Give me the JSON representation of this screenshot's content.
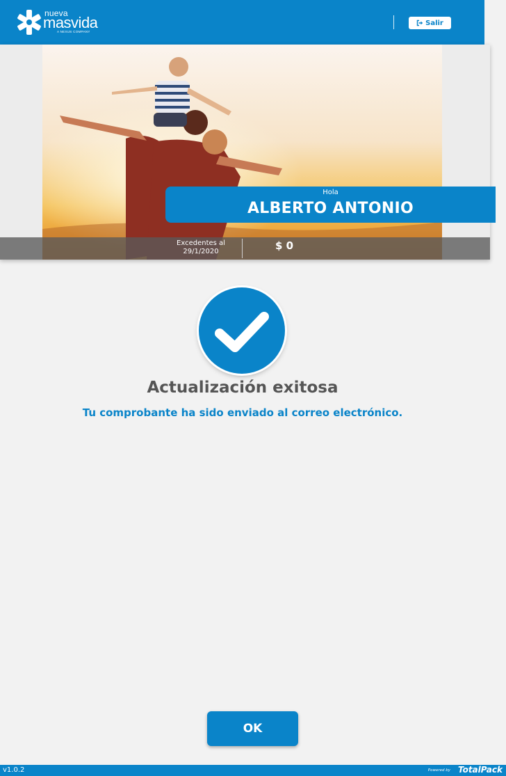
{
  "header": {
    "logo_small": "nueva",
    "logo_main": "masvida",
    "logo_tagline": "A NEXUS COMPANY",
    "logout_label": "Salir"
  },
  "hero": {
    "greeting": "Hola",
    "name": "ALBERTO ANTONIO",
    "info_label_line1": "Excedentes al",
    "info_label_line2": "29/1/2020",
    "info_value": "$ 0"
  },
  "result": {
    "title": "Actualización exitosa",
    "message": "Tu comprobante ha sido enviado al correo electrónico.",
    "ok_label": "OK"
  },
  "footer": {
    "version": "v1.0.2",
    "powered_by": "Powered by",
    "brand": "TotalPack"
  },
  "colors": {
    "primary": "#0a84c9",
    "background": "#f2f2f2",
    "title_gray": "#555555"
  },
  "icons": {
    "logout": "sign-out-icon",
    "success": "checkmark-icon",
    "logo": "masvida-logo-icon"
  }
}
